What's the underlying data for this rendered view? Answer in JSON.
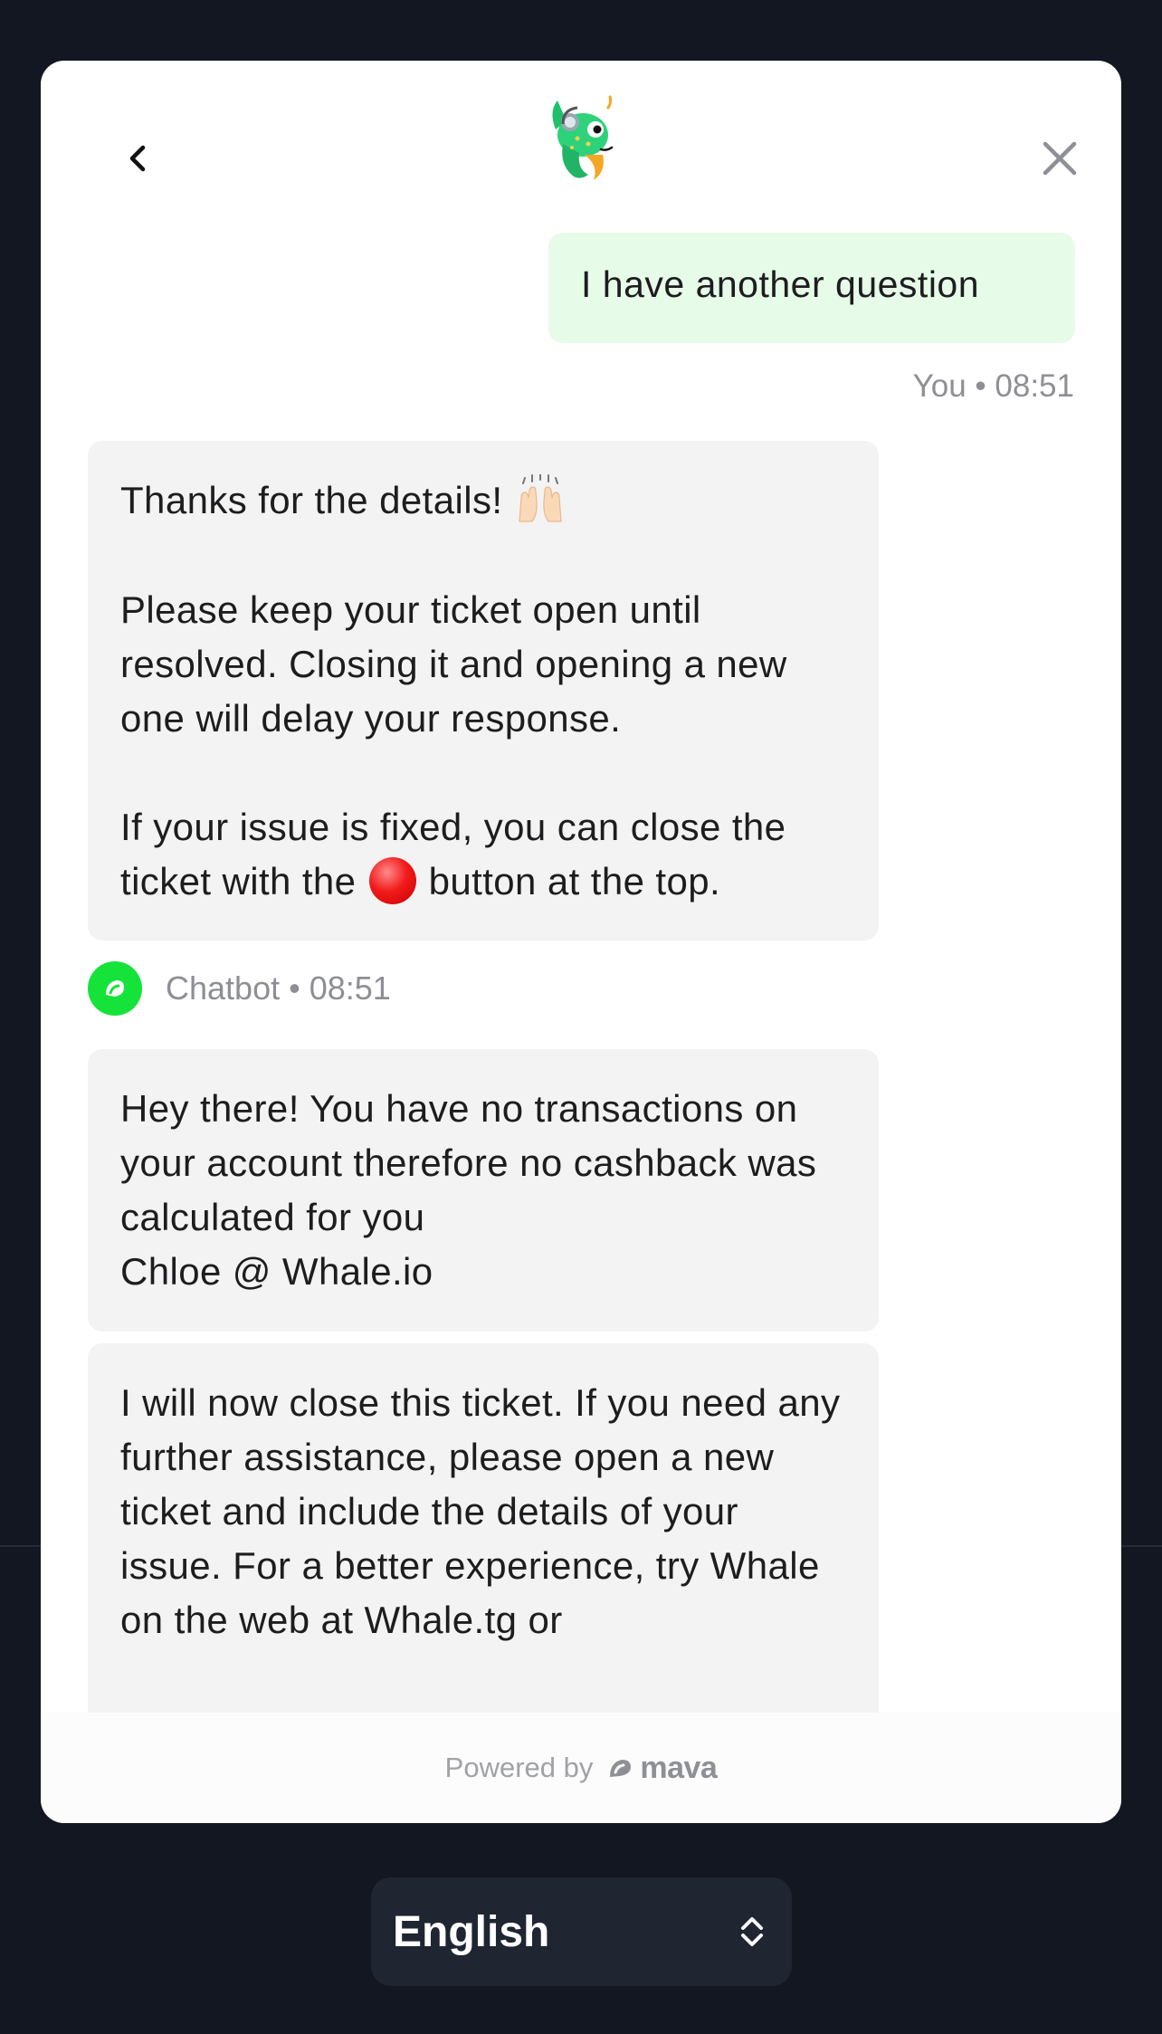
{
  "messages": {
    "user": {
      "text": "I have another question",
      "meta": "You • 08:51"
    },
    "bot_reply": {
      "line1": "Thanks for the details!",
      "para2": "Please keep your ticket open until resolved. Closing it and opening a new one will delay your response.",
      "para3_before": "If your issue is fixed, you can close the ticket with the",
      "para3_after": "button at the top.",
      "meta": "Chatbot • 08:51"
    },
    "agent_msg1": {
      "text": "Hey there! You have no transactions on your account therefore no cashback was calculated for you",
      "signature": "Chloe @ Whale.io"
    },
    "agent_msg2": {
      "text": "I will now close this ticket. If you need any further assistance, please open a new ticket and include the details of your issue. For a better experience, try Whale on the web at Whale.tg or"
    }
  },
  "footer": {
    "powered_by": "Powered by",
    "brand": "mava"
  },
  "language_select": {
    "selected": "English"
  },
  "icons": {
    "back": "chevron-left-icon",
    "close": "close-icon",
    "logo": "whale-mascot-logo",
    "bot_avatar": "mava-bot-icon",
    "language_toggle": "updown-chevron-icon"
  },
  "colors": {
    "backdrop": "#131721",
    "user_bubble": "#e7fbe9",
    "bot_bubble": "#f3f3f3",
    "bot_avatar": "#16e33a",
    "language_button": "#202532"
  }
}
